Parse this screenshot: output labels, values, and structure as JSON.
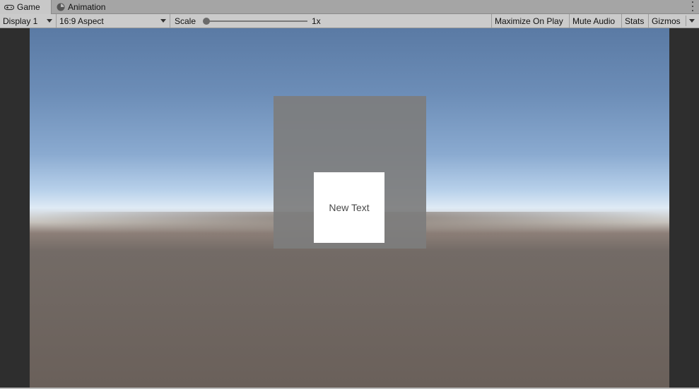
{
  "tabs": [
    {
      "label": "Game",
      "icon": "gamepad-icon",
      "active": true
    },
    {
      "label": "Animation",
      "icon": "clock-icon",
      "active": false
    }
  ],
  "toolbar": {
    "display": {
      "selected": "Display 1"
    },
    "aspect": {
      "selected": "16:9 Aspect"
    },
    "scale": {
      "label": "Scale",
      "value": "1x",
      "slider_fraction": 0.0
    },
    "maximize_on_play": "Maximize On Play",
    "mute_audio": "Mute Audio",
    "stats": "Stats",
    "gizmos": "Gizmos"
  },
  "scene": {
    "text_box": "New Text"
  },
  "colors": {
    "sky_top": "#5a7aa4",
    "horizon": "#dfeaf5",
    "ground": "#6a605a",
    "panel": "#7d7d7d",
    "letterbox": "#2e2e2e"
  }
}
